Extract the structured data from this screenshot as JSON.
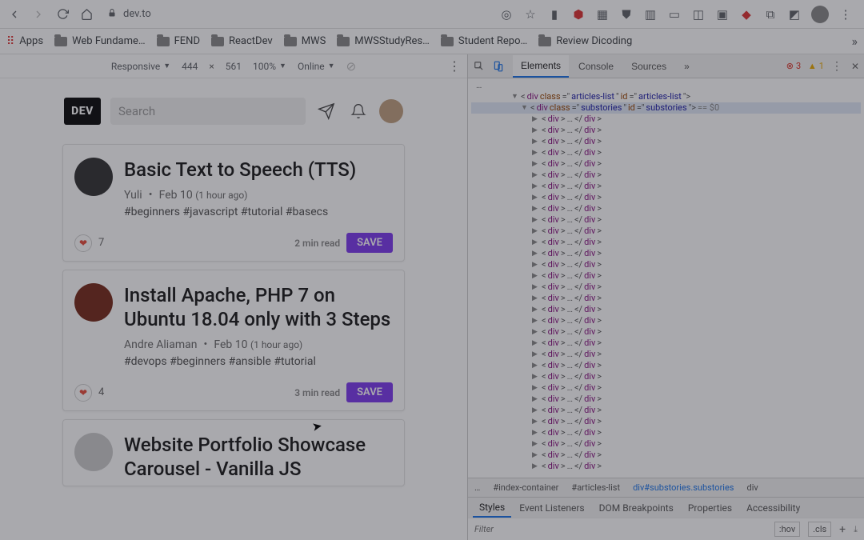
{
  "url": "dev.to",
  "bookmarks": [
    "Apps",
    "Web Fundame…",
    "FEND",
    "ReactDev",
    "MWS",
    "MWSStudyRes…",
    "Student Repo…",
    "Review Dicoding"
  ],
  "deviceBar": {
    "device": "Responsive",
    "width": "444",
    "height": "561",
    "zoom": "100%",
    "throttle": "Online"
  },
  "overlayLabel": "1",
  "devto": {
    "logo": "DEV",
    "searchPlaceholder": "Search"
  },
  "articles": [
    {
      "title": "Basic Text to Speech (TTS)",
      "author": "Yuli",
      "date": "Feb 10",
      "ago": "(1 hour ago)",
      "tags": "#beginners  #javascript  #tutorial  #basecs",
      "hearts": "7",
      "readtime": "2 min read",
      "save": "SAVE"
    },
    {
      "title": "Install Apache, PHP 7 on Ubuntu 18.04 only with 3 Steps",
      "author": "Andre Aliaman",
      "date": "Feb 10",
      "ago": "(1 hour ago)",
      "tags": "#devops  #beginners  #ansible  #tutorial",
      "hearts": "4",
      "readtime": "3 min read",
      "save": "SAVE"
    },
    {
      "title": "Website Portfolio Showcase Carousel - Vanilla JS",
      "author": "",
      "date": "",
      "ago": "",
      "tags": "",
      "hearts": "",
      "readtime": "",
      "save": ""
    }
  ],
  "devtools": {
    "tabs": [
      "Elements",
      "Console",
      "Sources"
    ],
    "errors": "3",
    "warnings": "1",
    "tree": {
      "line1": {
        "tag": "div",
        "cls": "articles-list",
        "id": "articles-list"
      },
      "line2": {
        "tag": "div",
        "cls": "substories",
        "id": "substories",
        "dims": "== $0"
      },
      "childCount": 32
    },
    "breadcrumb": [
      "…",
      "#index-container",
      "#articles-list",
      "div#substories.substories",
      "div"
    ],
    "styleTabs": [
      "Styles",
      "Event Listeners",
      "DOM Breakpoints",
      "Properties",
      "Accessibility"
    ],
    "filterPlaceholder": "Filter",
    "hov": ":hov",
    "cls": ".cls"
  }
}
